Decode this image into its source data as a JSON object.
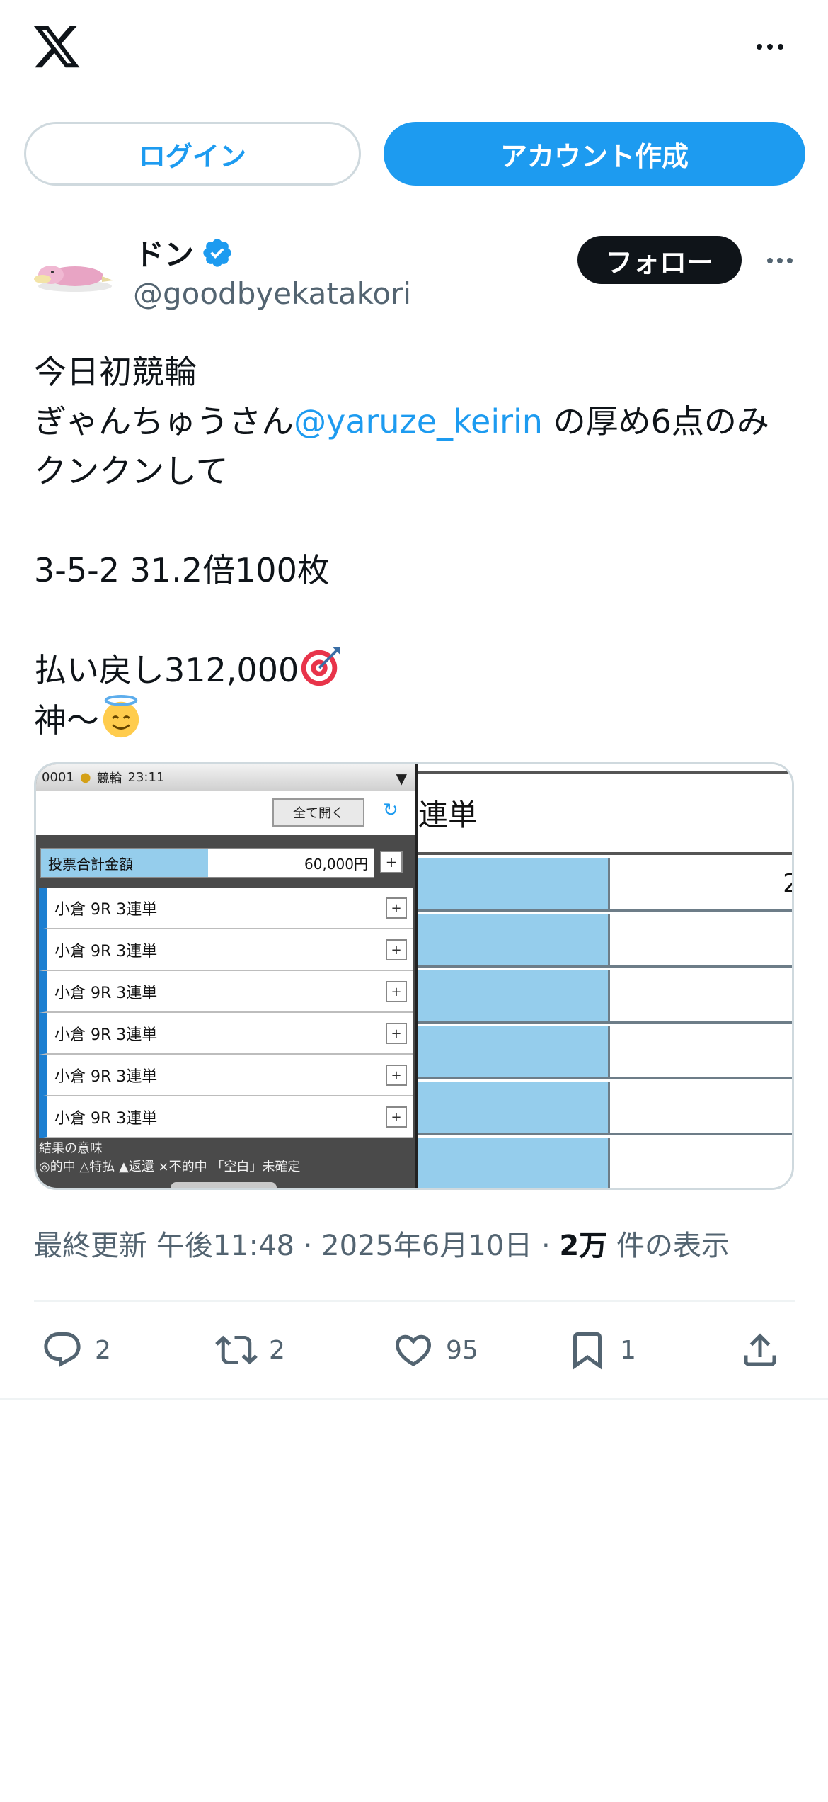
{
  "header": {
    "logo": "x-logo-icon",
    "more_icon": "more-horizontal-icon"
  },
  "auth": {
    "login_label": "ログイン",
    "signup_label": "アカウント作成"
  },
  "author": {
    "display_name": "ドン",
    "verified_icon": "verified-badge-icon",
    "handle": "@goodbyekatakori",
    "follow_label": "フォロー"
  },
  "tweet": {
    "line1": "今日初競輪",
    "line2_prefix": "ぎゃんちゅうさん",
    "mention": "@yaruze_keirin",
    "line2_suffix": " の厚め6点のみ",
    "line3": "クンクンして",
    "line4": "3-5-2 31.2倍100枚",
    "line5": "払い戻し312,000",
    "line5_emoji": "direct-hit-emoji",
    "line6": "神〜",
    "line6_emoji": "smiling-face-with-halo-emoji"
  },
  "media": {
    "phone_header": "0001",
    "phone_header_app": "競輪",
    "phone_header_time": "23:11",
    "open_all_label": "全て開く",
    "total_label": "投票合計金額",
    "total_value": "60,000円",
    "bets": [
      {
        "label": "小倉 9R 3連単"
      },
      {
        "label": "小倉 9R 3連単"
      },
      {
        "label": "小倉 9R 3連単"
      },
      {
        "label": "小倉 9R 3連単"
      },
      {
        "label": "小倉 9R 3連単"
      },
      {
        "label": "小倉 9R 3連単"
      }
    ],
    "legend_title": "結果の意味",
    "legend_body": "◎的中 △特払 ▲返還 ×不的中 「空白」未確定",
    "table_title": "連単",
    "table_first_value": "2"
  },
  "meta": {
    "prefix": "最終更新 午後11:48 · 2025年6月10日 · ",
    "views_count": "2万",
    "views_suffix": " 件の表示"
  },
  "actions": {
    "reply_count": "2",
    "retweet_count": "2",
    "like_count": "95",
    "bookmark_count": "1"
  },
  "colors": {
    "accent": "#1d9bf0",
    "text": "#0f1419",
    "muted": "#536471",
    "border": "#cfd9de"
  }
}
